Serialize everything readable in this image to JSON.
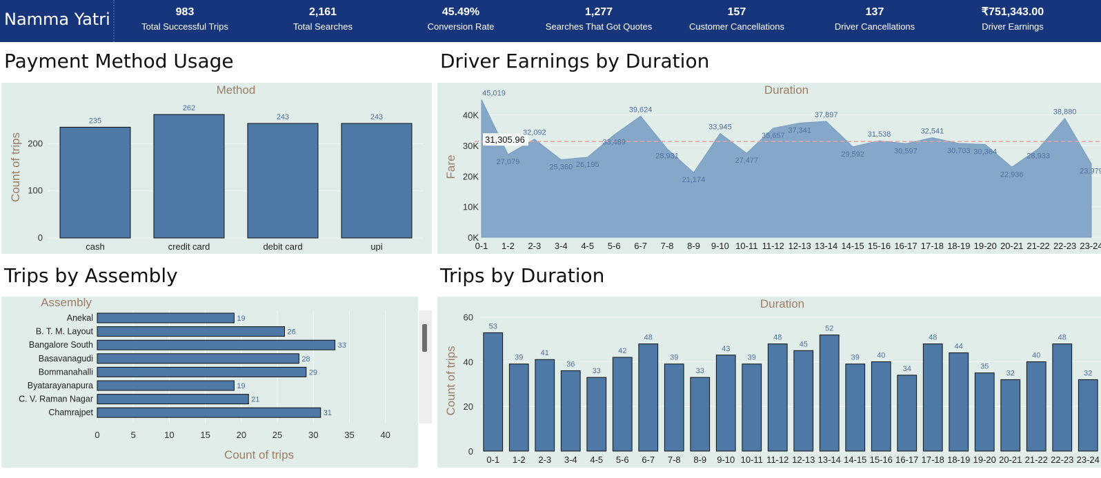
{
  "header": {
    "brand": "Namma Yatri",
    "kpis": [
      {
        "value": "983",
        "label": "Total Successful Trips"
      },
      {
        "value": "2,161",
        "label": "Total Searches"
      },
      {
        "value": "45.49%",
        "label": "Conversion Rate"
      },
      {
        "value": "1,277",
        "label": "Searches That Got Quotes"
      },
      {
        "value": "157",
        "label": "Customer Cancellations"
      },
      {
        "value": "137",
        "label": "Driver Cancellations"
      },
      {
        "value": "₹751,343.00",
        "label": "Driver Earnings"
      }
    ]
  },
  "sections": {
    "payment": "Payment Method Usage",
    "earnings": "Driver Earnings by Duration",
    "assembly": "Trips by Assembly",
    "duration": "Trips by Duration"
  },
  "colors": {
    "header_bg": "#16357a",
    "panel_bg": "#e0ede9",
    "bar": "#4e79a7",
    "area": "#86a8c8",
    "axis_title": "#9c7d66",
    "label_blue": "#4f6fa0",
    "ref_line": "#e8a0a0"
  },
  "chart_data": [
    {
      "type": "bar",
      "title": "Payment Method Usage",
      "header": "Method",
      "categories": [
        "cash",
        "credit card",
        "debit card",
        "upi"
      ],
      "values": [
        235,
        262,
        243,
        243
      ],
      "xlabel": "",
      "ylabel": "Count of trips",
      "ylim": [
        0,
        300
      ],
      "yticks": [
        0,
        100,
        200
      ],
      "grid": true
    },
    {
      "type": "area",
      "title": "Driver Earnings by Duration",
      "header": "Duration",
      "categories": [
        "0-1",
        "1-2",
        "2-3",
        "3-4",
        "4-5",
        "5-6",
        "6-7",
        "7-8",
        "8-9",
        "9-10",
        "10-11",
        "11-12",
        "12-13",
        "13-14",
        "14-15",
        "15-16",
        "16-17",
        "17-18",
        "18-19",
        "19-20",
        "20-21",
        "21-22",
        "22-23",
        "23-24"
      ],
      "values": [
        45019,
        27079,
        32092,
        25360,
        26195,
        33489,
        39624,
        28931,
        21174,
        33945,
        27477,
        35657,
        37341,
        37897,
        29592,
        31538,
        30597,
        32541,
        30703,
        30364,
        22936,
        28933,
        38880,
        23979
      ],
      "ylabel": "Fare",
      "ylim": [
        0,
        46000
      ],
      "yticks": [
        0,
        10000,
        20000,
        30000,
        40000
      ],
      "ytick_labels": [
        "0K",
        "10K",
        "20K",
        "30K",
        "40K"
      ],
      "reference_line": {
        "value": 31305.96,
        "label": "31,305.96"
      },
      "grid": true
    },
    {
      "type": "bar",
      "orientation": "horizontal",
      "title": "Trips by Assembly",
      "header": "Assembly",
      "categories": [
        "Anekal",
        "B. T. M. Layout",
        "Bangalore South",
        "Basavanagudi",
        "Bommanahalli",
        "Byatarayanapura",
        "C. V. Raman Nagar",
        "Chamrajpet"
      ],
      "values": [
        19,
        26,
        33,
        28,
        29,
        19,
        21,
        31
      ],
      "xlabel": "Count of trips",
      "xlim": [
        0,
        43
      ],
      "xticks": [
        0,
        5,
        10,
        15,
        20,
        25,
        30,
        35,
        40
      ],
      "grid": true
    },
    {
      "type": "bar",
      "title": "Trips by Duration",
      "header": "Duration",
      "categories": [
        "0-1",
        "1-2",
        "2-3",
        "3-4",
        "4-5",
        "5-6",
        "6-7",
        "7-8",
        "8-9",
        "9-10",
        "10-11",
        "11-12",
        "12-13",
        "13-14",
        "14-15",
        "15-16",
        "16-17",
        "17-18",
        "18-19",
        "19-20",
        "20-21",
        "21-22",
        "22-23",
        "23-24"
      ],
      "values": [
        53,
        39,
        41,
        36,
        33,
        42,
        48,
        39,
        33,
        43,
        39,
        48,
        45,
        52,
        39,
        40,
        34,
        48,
        44,
        35,
        32,
        40,
        48,
        32
      ],
      "ylabel": "Count of trips",
      "ylim": [
        0,
        63
      ],
      "yticks": [
        0,
        20,
        40,
        60
      ],
      "grid": true
    }
  ]
}
